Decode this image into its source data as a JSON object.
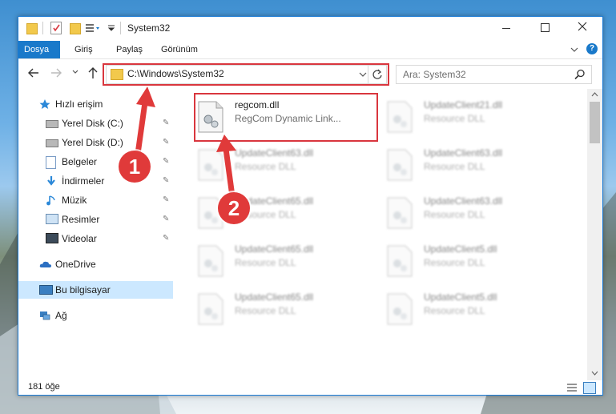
{
  "window": {
    "title": "System32",
    "tabs": [
      "Dosya",
      "Giriş",
      "Paylaş",
      "Görünüm"
    ],
    "controls": {
      "minimize": "minimize-icon",
      "maximize": "maximize-icon",
      "close": "close-icon"
    }
  },
  "navbar": {
    "address": "C:\\Windows\\System32",
    "search_placeholder": "Ara: System32"
  },
  "sidebar": {
    "items": [
      {
        "label": "Hızlı erişim",
        "icon": "star-icon",
        "pinned": false
      },
      {
        "label": "Yerel Disk (C:)",
        "icon": "drive-icon",
        "pinned": true
      },
      {
        "label": "Yerel Disk (D:)",
        "icon": "drive-icon",
        "pinned": true
      },
      {
        "label": "Belgeler",
        "icon": "documents-icon",
        "pinned": true
      },
      {
        "label": "İndirmeler",
        "icon": "download-icon",
        "pinned": true
      },
      {
        "label": "Müzik",
        "icon": "music-icon",
        "pinned": true
      },
      {
        "label": "Resimler",
        "icon": "pictures-icon",
        "pinned": true
      },
      {
        "label": "Videolar",
        "icon": "videos-icon",
        "pinned": true
      },
      {
        "label": "OneDrive",
        "icon": "cloud-icon",
        "pinned": false
      },
      {
        "label": "Bu bilgisayar",
        "icon": "computer-icon",
        "pinned": false,
        "selected": true
      },
      {
        "label": "Ağ",
        "icon": "network-icon",
        "pinned": false
      }
    ]
  },
  "files": [
    {
      "name": "regcom.dll",
      "desc": "RegCom Dynamic Link...",
      "blurred": false
    },
    {
      "name": "UpdateClient21.dll",
      "desc": "Resource DLL",
      "blurred": true
    },
    {
      "name": "UpdateClient63.dll",
      "desc": "Resource DLL",
      "blurred": true
    },
    {
      "name": "UpdateClient63.dll",
      "desc": "Resource DLL",
      "blurred": true
    },
    {
      "name": "UpdateClient65.dll",
      "desc": "Resource DLL",
      "blurred": true
    },
    {
      "name": "UpdateClient63.dll",
      "desc": "Resource DLL",
      "blurred": true
    },
    {
      "name": "UpdateClient65.dll",
      "desc": "Resource DLL",
      "blurred": true
    },
    {
      "name": "UpdateClient5.dll",
      "desc": "Resource DLL",
      "blurred": true
    },
    {
      "name": "UpdateClient65.dll",
      "desc": "Resource DLL",
      "blurred": true
    },
    {
      "name": "UpdateClient5.dll",
      "desc": "Resource DLL",
      "blurred": true
    }
  ],
  "status": {
    "item_count": "181 öğe"
  },
  "annotations": {
    "step1": "1",
    "step2": "2"
  },
  "colors": {
    "accent": "#1979ca",
    "highlight": "#d9363e",
    "selected": "#cce8ff"
  }
}
